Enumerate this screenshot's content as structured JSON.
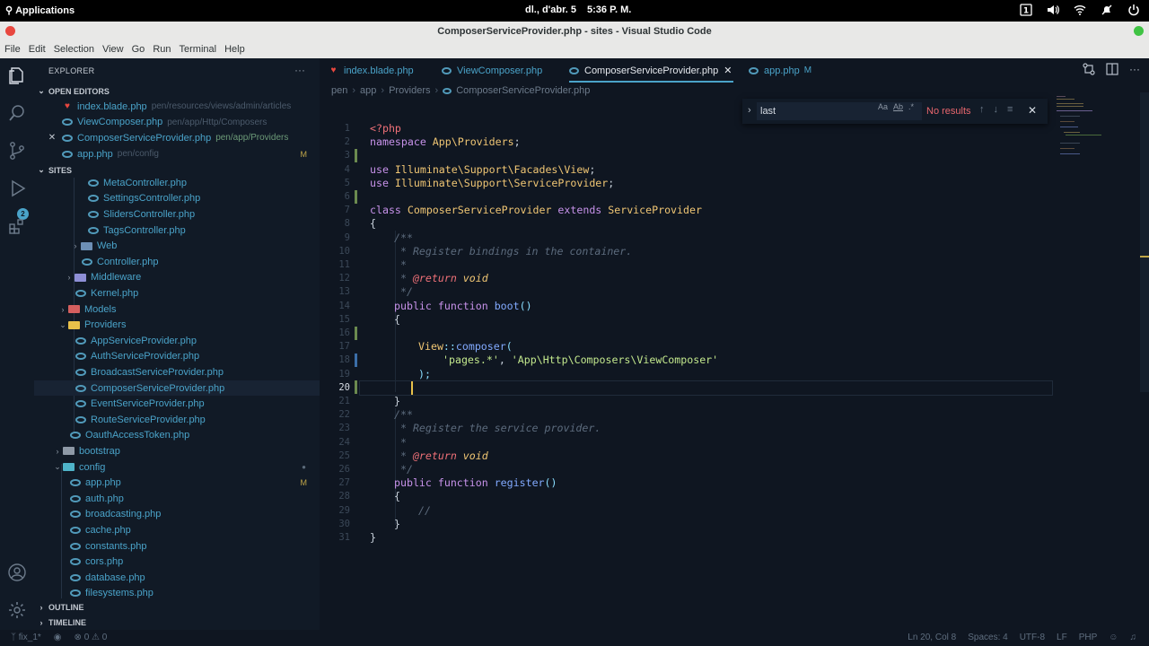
{
  "system": {
    "apps_label": "Applications",
    "date": "dl., d'abr. 5",
    "time": "5:36 P. M."
  },
  "window": {
    "title": "ComposerServiceProvider.php - sites - Visual Studio Code",
    "menu": [
      "File",
      "Edit",
      "Selection",
      "View",
      "Go",
      "Run",
      "Terminal",
      "Help"
    ]
  },
  "activity": {
    "scm_badge": "2"
  },
  "sidebar": {
    "title": "EXPLORER",
    "more": "···",
    "open_editors": {
      "label": "OPEN EDITORS",
      "items": [
        {
          "name": "index.blade.php",
          "path": "pen/resources/views/admin/articles"
        },
        {
          "name": "ViewComposer.php",
          "path": "pen/app/Http/Composers"
        },
        {
          "name": "ComposerServiceProvider.php",
          "path": "pen/app/Providers"
        },
        {
          "name": "app.php",
          "path": "pen/config",
          "mark": "M"
        }
      ]
    },
    "sites_label": "SITES",
    "tree": [
      "MetaController.php",
      "SettingsController.php",
      "SlidersController.php",
      "TagsController.php",
      "Web",
      "Controller.php",
      "Middleware",
      "Kernel.php",
      "Models",
      "Providers",
      "AppServiceProvider.php",
      "AuthServiceProvider.php",
      "BroadcastServiceProvider.php",
      "ComposerServiceProvider.php",
      "EventServiceProvider.php",
      "RouteServiceProvider.php",
      "OauthAccessToken.php",
      "bootstrap",
      "config",
      "app.php",
      "auth.php",
      "broadcasting.php",
      "cache.php",
      "constants.php",
      "cors.php",
      "database.php",
      "filesystems.php"
    ],
    "app_mark": "M",
    "outline_label": "OUTLINE",
    "timeline_label": "TIMELINE"
  },
  "tabs": [
    {
      "label": "index.blade.php"
    },
    {
      "label": "ViewComposer.php"
    },
    {
      "label": "ComposerServiceProvider.php"
    },
    {
      "label": "app.php",
      "mark": "M"
    }
  ],
  "breadcrumb": [
    "pen",
    "app",
    "Providers",
    "ComposerServiceProvider.php"
  ],
  "find": {
    "value": "last",
    "opt_case": "Aa",
    "opt_word": "Ab",
    "opt_regex": ".*",
    "result": "No results"
  },
  "code": {
    "line_numbers": [
      "1",
      "2",
      "3",
      "4",
      "5",
      "6",
      "7",
      "8",
      "9",
      "10",
      "11",
      "12",
      "13",
      "14",
      "15",
      "16",
      "17",
      "18",
      "19",
      "20",
      "21",
      "22",
      "23",
      "24",
      "25",
      "26",
      "27",
      "28",
      "29",
      "30",
      "31"
    ],
    "lines": {
      "l1": "<?php",
      "l2a": "namespace",
      "l2b": " App\\Providers",
      "l2c": ";",
      "l4a": "use",
      "l4b": " Illuminate\\Support\\Facades\\View",
      "l4c": ";",
      "l5a": "use",
      "l5b": " Illuminate\\Support\\ServiceProvider",
      "l5c": ";",
      "l7a": "class",
      "l7b": " ComposerServiceProvider",
      "l7c": " extends",
      "l7d": " ServiceProvider",
      "l8": "{",
      "l9": "/**",
      "l10": " * Register bindings in the container.",
      "l11": " *",
      "l12a": " * ",
      "l12b": "@return",
      "l12c": " void",
      "l13": " */",
      "l14a": "public",
      "l14b": " function",
      "l14c": " boot",
      "l14d": "()",
      "l15": "{",
      "l17a": "View",
      "l17b": "::",
      "l17c": "composer",
      "l17d": "(",
      "l18a": "'pages.*'",
      "l18b": ", ",
      "l18c": "'App\\Http\\Composers\\ViewComposer'",
      "l19": ");",
      "l21": "}",
      "l22": "/**",
      "l23": " * Register the service provider.",
      "l24": " *",
      "l25a": " * ",
      "l25b": "@return",
      "l25c": " void",
      "l26": " */",
      "l27a": "public",
      "l27b": " function",
      "l27c": " register",
      "l27d": "()",
      "l28": "{",
      "l29": "//",
      "l30": "}",
      "l31": "}"
    }
  },
  "status": {
    "branch": "fix_1*",
    "problems": "⊗ 0 ⚠ 0",
    "position": "Ln 20, Col 8",
    "spaces": "Spaces: 4",
    "encoding": "UTF-8",
    "eol": "LF",
    "language": "PHP"
  },
  "colors": {
    "accent": "#4aa3c9",
    "background": "#0f1621",
    "modified": "#c0a648",
    "error": "#e8666d"
  }
}
